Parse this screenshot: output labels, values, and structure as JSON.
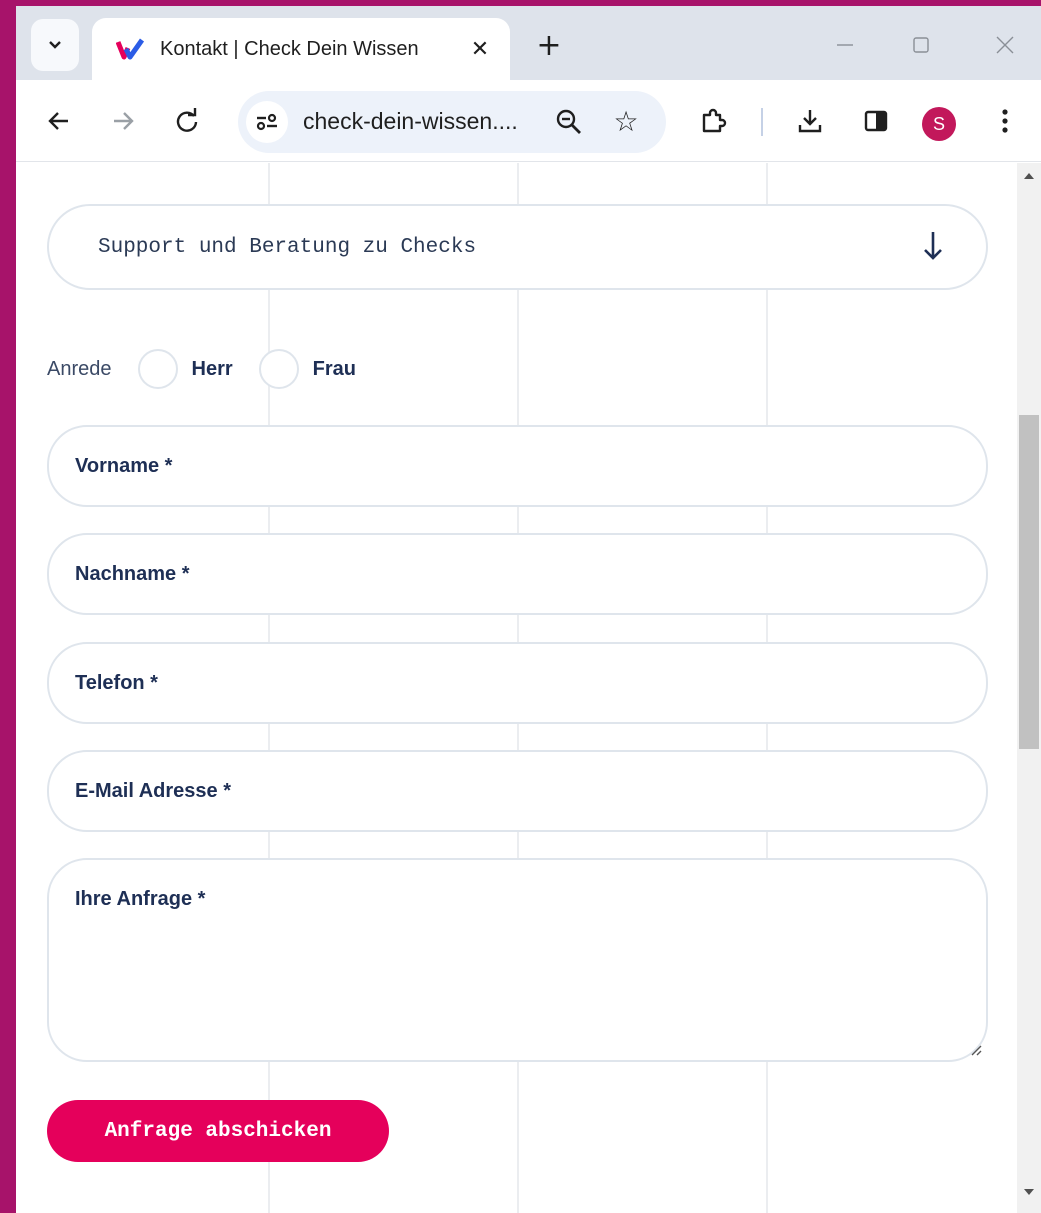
{
  "browser": {
    "tab": {
      "title": "Kontakt | Check Dein Wissen",
      "close_glyph": "✕",
      "favicon": "check-dein-wissen-logo"
    },
    "new_tab_glyph": "+",
    "star_glyph": "☆",
    "address": {
      "url": "check-dein-wissen...."
    },
    "profile_initial": "S",
    "icons": [
      "tab-search-icon",
      "back-icon",
      "forward-icon",
      "reload-icon",
      "site-settings-icon",
      "zoom-icon",
      "bookmark-star-icon",
      "extensions-icon",
      "download-icon",
      "side-panel-icon",
      "menu-icon",
      "minimize-icon",
      "maximize-icon",
      "close-icon"
    ],
    "colors": {
      "profile": "#c2185b",
      "frame": "#a7136a"
    }
  },
  "form": {
    "subject": "Support und Beratung zu Checks",
    "anrede": {
      "label": "Anrede",
      "options": [
        "Herr",
        "Frau"
      ]
    },
    "fields": {
      "vorname": "Vorname *",
      "nachname": "Nachname *",
      "telefon": "Telefon *",
      "email": "E-Mail Adresse *",
      "anfrage": "Ihre Anfrage *"
    },
    "submit": "Anfrage abschicken",
    "colors": {
      "accent": "#e5005b",
      "label": "#1e2f55"
    }
  }
}
